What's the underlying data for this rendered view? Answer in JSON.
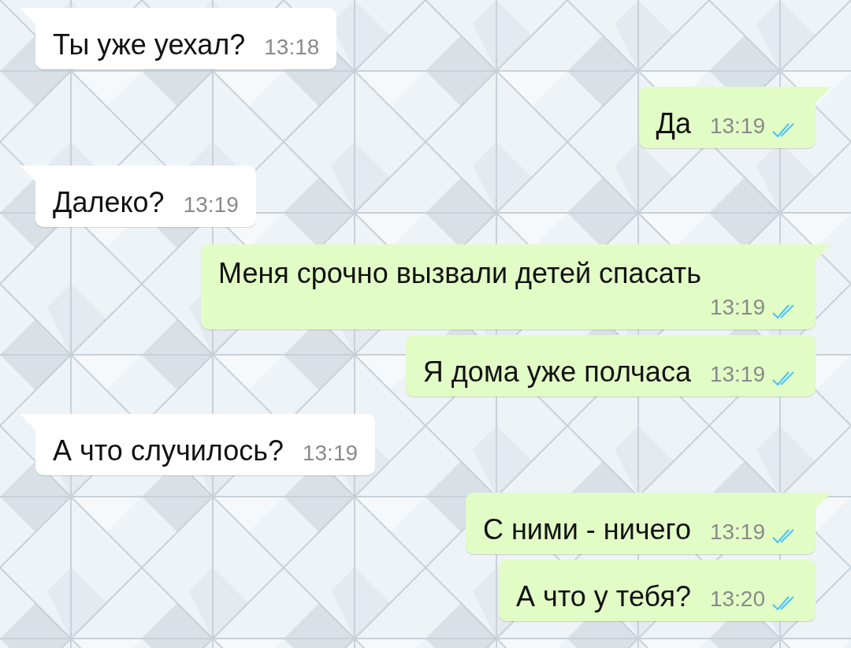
{
  "messages": [
    {
      "kind": "incoming",
      "tail": true,
      "text": "Ты уже уехал?",
      "time": "13:18"
    },
    {
      "kind": "outgoing",
      "tail": true,
      "text": "Да",
      "time": "13:19",
      "read": true
    },
    {
      "kind": "incoming",
      "tail": true,
      "text": "Далеко?",
      "time": "13:19"
    },
    {
      "kind": "outgoing",
      "tail": true,
      "text": "Меня срочно вызвали детей спасать",
      "time": "13:19",
      "read": true
    },
    {
      "kind": "outgoing",
      "tail": false,
      "text": "Я дома уже полчаса",
      "time": "13:19",
      "read": true
    },
    {
      "kind": "incoming",
      "tail": true,
      "text": "А что случилось?",
      "time": "13:19"
    },
    {
      "kind": "outgoing",
      "tail": true,
      "text": "С ними - ничего",
      "time": "13:19",
      "read": true
    },
    {
      "kind": "outgoing",
      "tail": false,
      "text": "А что у тебя?",
      "time": "13:20",
      "read": true
    }
  ]
}
